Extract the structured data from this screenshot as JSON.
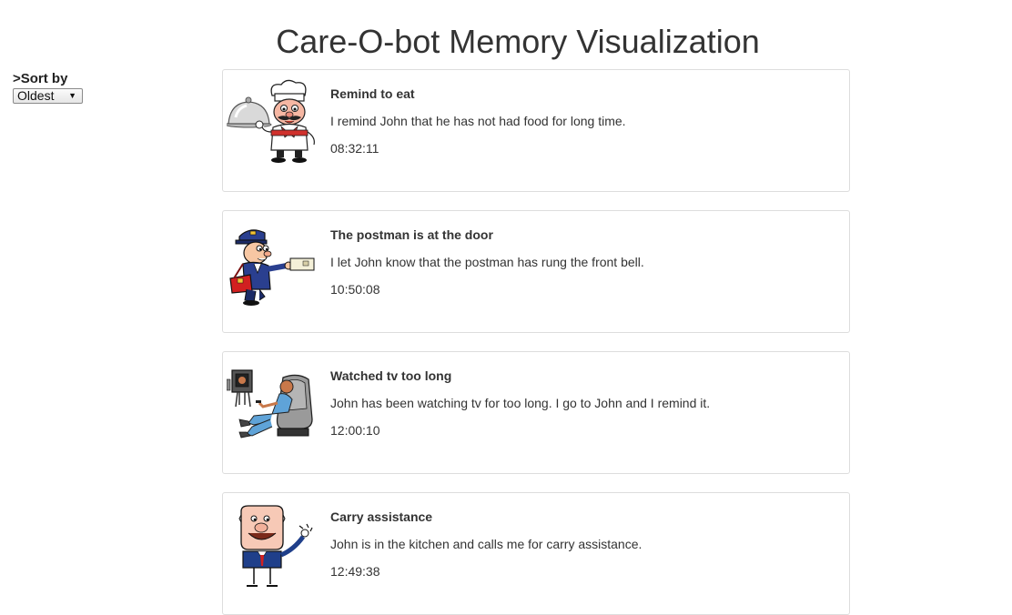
{
  "page": {
    "title": "Care-O-bot Memory Visualization"
  },
  "sort": {
    "label": ">Sort by",
    "selected": "Oldest"
  },
  "memories": [
    {
      "title": "Remind to eat",
      "description": "I remind John that he has not had food for long time.",
      "time": "08:32:11",
      "icon": "chef-icon"
    },
    {
      "title": "The postman is at the door",
      "description": "I let John know that the postman has rung the front bell.",
      "time": "10:50:08",
      "icon": "postman-icon"
    },
    {
      "title": "Watched tv too long",
      "description": "John has been watching tv for too long. I go to John and I remind it.",
      "time": "12:00:10",
      "icon": "tv-viewer-icon"
    },
    {
      "title": "Carry assistance",
      "description": "John is in the kitchen and calls me for carry assistance.",
      "time": "12:49:38",
      "icon": "waving-man-icon"
    }
  ]
}
